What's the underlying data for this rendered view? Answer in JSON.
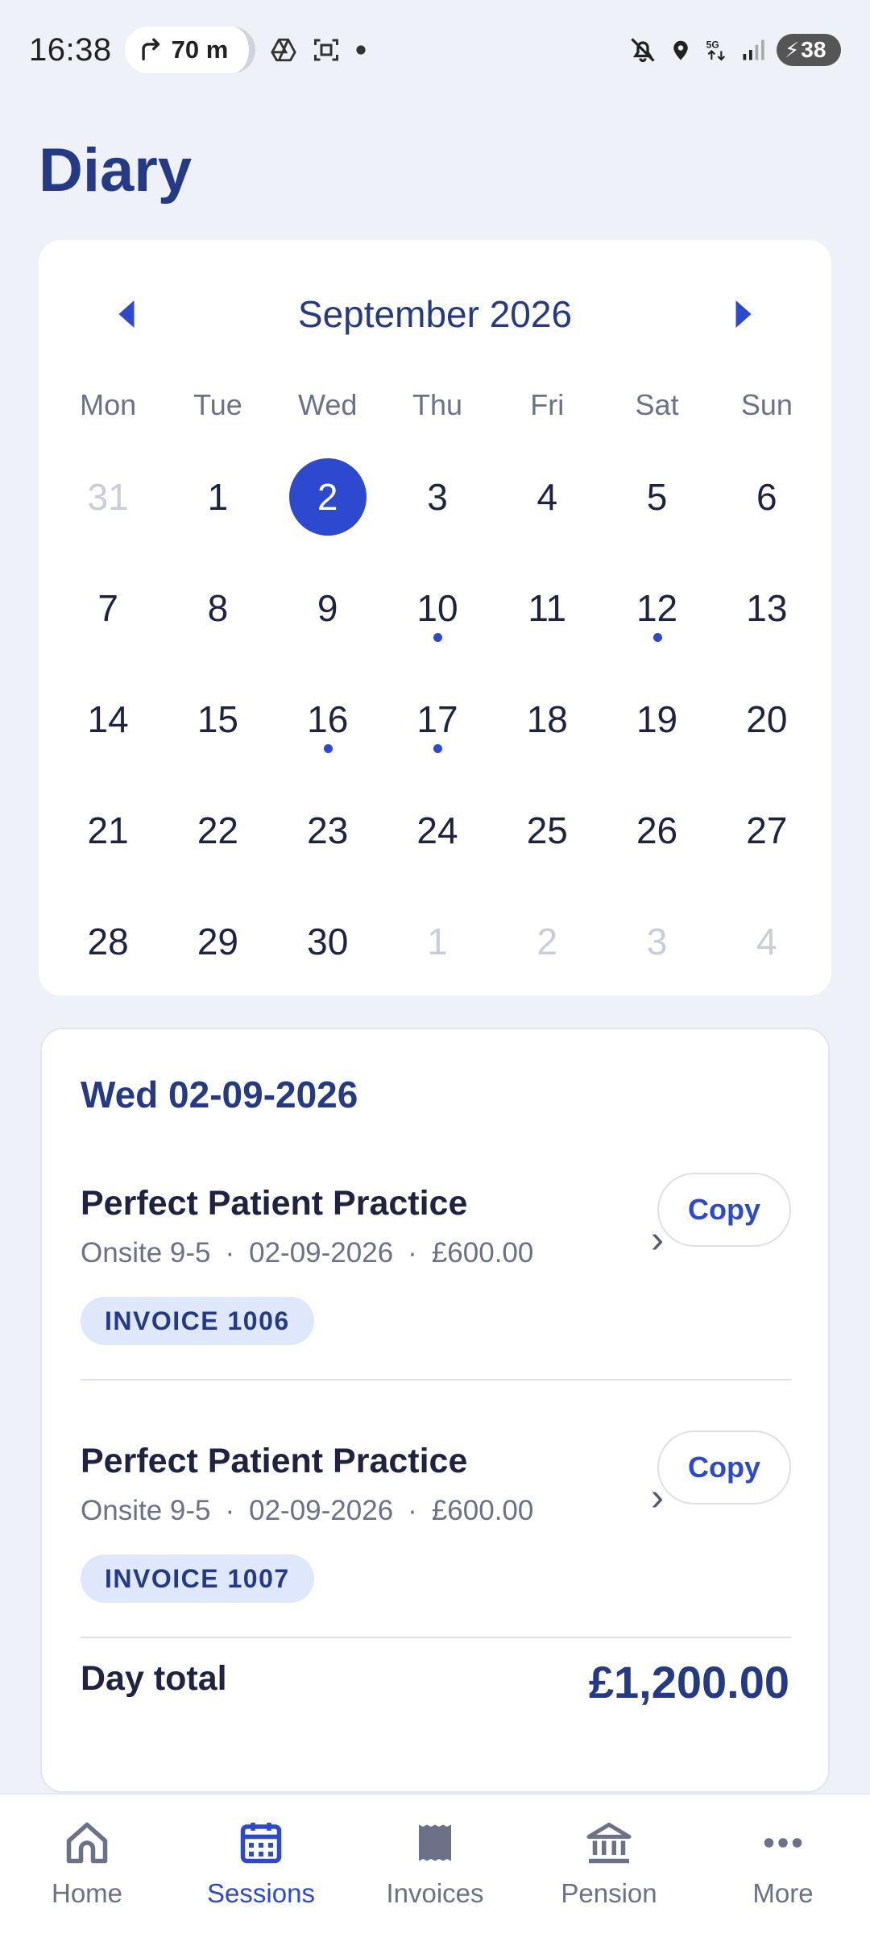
{
  "status_bar": {
    "time": "16:38",
    "nav_distance": "70 m",
    "battery": "38"
  },
  "page": {
    "title": "Diary"
  },
  "calendar": {
    "month_label": "September 2026",
    "weekdays": [
      "Mon",
      "Tue",
      "Wed",
      "Thu",
      "Fri",
      "Sat",
      "Sun"
    ],
    "days": [
      {
        "d": "31",
        "muted": true
      },
      {
        "d": "1"
      },
      {
        "d": "2",
        "selected": true
      },
      {
        "d": "3"
      },
      {
        "d": "4"
      },
      {
        "d": "5"
      },
      {
        "d": "6"
      },
      {
        "d": "7"
      },
      {
        "d": "8"
      },
      {
        "d": "9"
      },
      {
        "d": "10",
        "event": true
      },
      {
        "d": "11"
      },
      {
        "d": "12",
        "event": true
      },
      {
        "d": "13"
      },
      {
        "d": "14"
      },
      {
        "d": "15"
      },
      {
        "d": "16",
        "event": true
      },
      {
        "d": "17",
        "event": true
      },
      {
        "d": "18"
      },
      {
        "d": "19"
      },
      {
        "d": "20"
      },
      {
        "d": "21"
      },
      {
        "d": "22"
      },
      {
        "d": "23"
      },
      {
        "d": "24"
      },
      {
        "d": "25"
      },
      {
        "d": "26"
      },
      {
        "d": "27"
      },
      {
        "d": "28"
      },
      {
        "d": "29"
      },
      {
        "d": "30"
      },
      {
        "d": "1",
        "muted": true
      },
      {
        "d": "2",
        "muted": true
      },
      {
        "d": "3",
        "muted": true
      },
      {
        "d": "4",
        "muted": true
      }
    ]
  },
  "day_detail": {
    "date_label": "Wed 02-09-2026",
    "sessions": [
      {
        "practice": "Perfect Patient Practice",
        "type": "Onsite 9-5",
        "date": "02-09-2026",
        "amount": "£600.00",
        "invoice": "INVOICE 1006",
        "copy_label": "Copy"
      },
      {
        "practice": "Perfect Patient Practice",
        "type": "Onsite 9-5",
        "date": "02-09-2026",
        "amount": "£600.00",
        "invoice": "INVOICE 1007",
        "copy_label": "Copy"
      }
    ],
    "total_label": "Day total",
    "total_value": "£1,200.00"
  },
  "bottom_nav": {
    "items": [
      {
        "label": "Home",
        "icon": "home-icon"
      },
      {
        "label": "Sessions",
        "icon": "calendar-icon",
        "active": true
      },
      {
        "label": "Invoices",
        "icon": "receipt-icon"
      },
      {
        "label": "Pension",
        "icon": "bank-icon"
      },
      {
        "label": "More",
        "icon": "more-dots-icon"
      }
    ]
  },
  "colors": {
    "accent": "#2d49cf",
    "title": "#243a86",
    "background": "#eef1f8",
    "badge_bg": "#dfe8fa"
  }
}
